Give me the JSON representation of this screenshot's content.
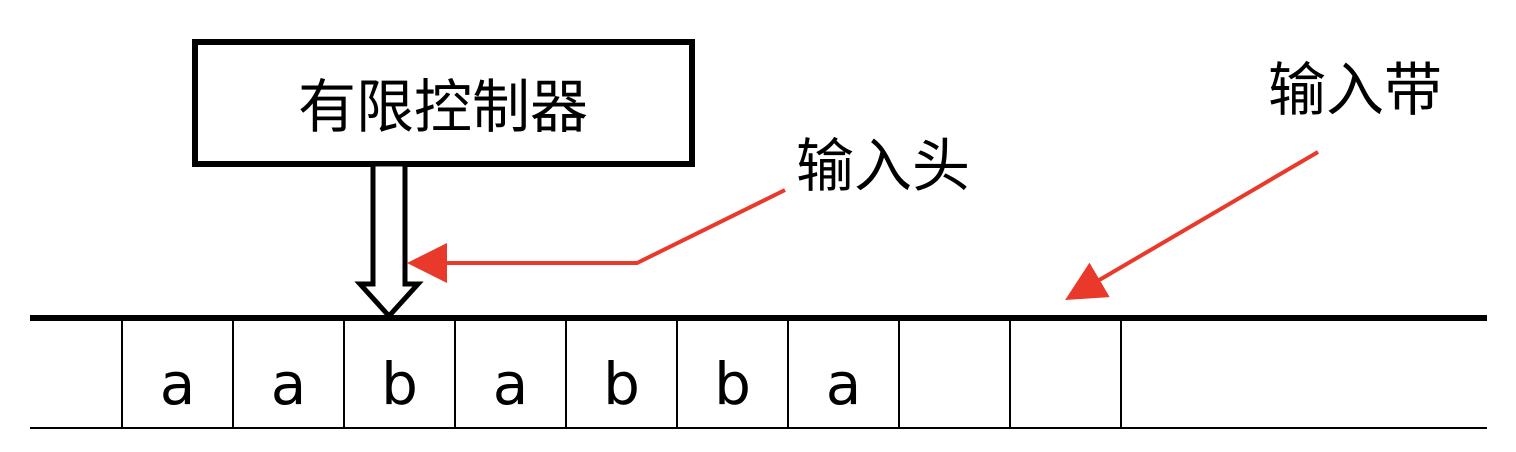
{
  "controller": {
    "label": "有限控制器"
  },
  "labels": {
    "input_head": "输入头",
    "input_tape": "输入带"
  },
  "tape": {
    "cells": [
      "",
      "a",
      "a",
      "b",
      "a",
      "b",
      "b",
      "a",
      "",
      "",
      ""
    ]
  },
  "colors": {
    "stroke": "#000000",
    "pointer_arrow": "#e8392b",
    "background": "#ffffff"
  }
}
